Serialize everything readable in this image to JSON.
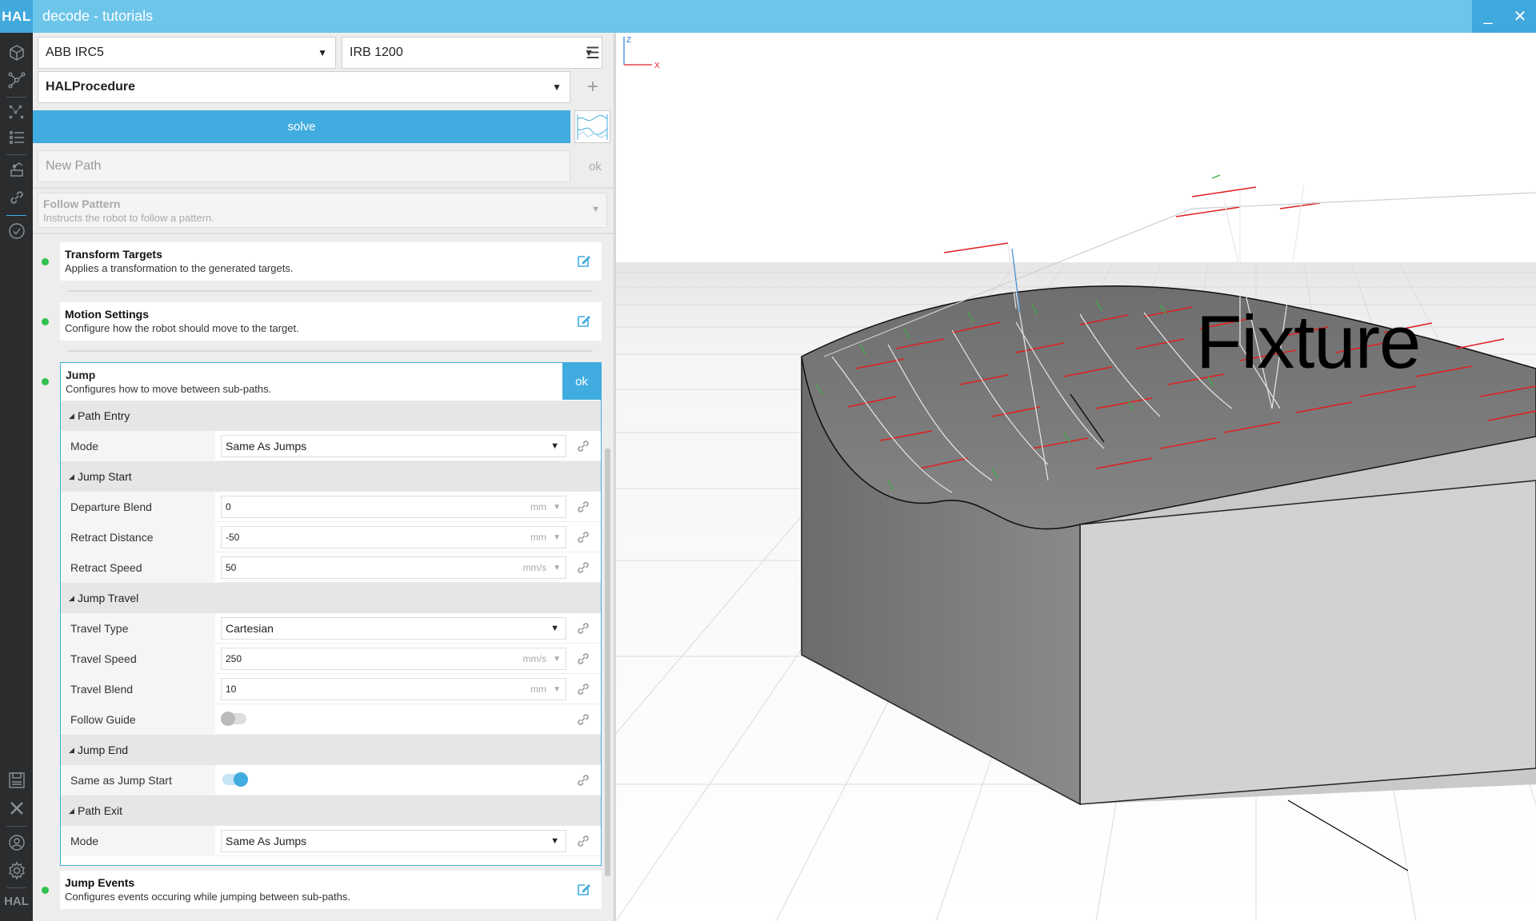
{
  "titlebar": {
    "logo": "HAL",
    "title": "decode - tutorials",
    "minimize": "_",
    "close": "✕"
  },
  "rail": {
    "brand": "HAL",
    "icons": [
      "cube-icon",
      "network-icon",
      "scatter-icon",
      "list-icon",
      "robot-icon",
      "link-icon",
      "check-icon",
      "save-icon",
      "close-icon",
      "user-icon",
      "gear-icon"
    ]
  },
  "panel": {
    "controller": "ABB IRC5",
    "robot": "IRB 1200",
    "procedure": "HALProcedure",
    "solve_label": "solve",
    "new_path_placeholder": "New Path",
    "new_path_ok": "ok",
    "pattern": {
      "title": "Follow Pattern",
      "desc": "Instructs the robot to follow a pattern."
    },
    "steps": [
      {
        "title": "Transform Targets",
        "desc": "Applies a transformation to the generated targets."
      },
      {
        "title": "Motion Settings",
        "desc": "Configure how the robot should move to the target."
      }
    ],
    "jump": {
      "title": "Jump",
      "desc": "Configures how to move between sub-paths.",
      "ok": "ok",
      "sections": {
        "path_entry": "Path Entry",
        "jump_start": "Jump Start",
        "jump_travel": "Jump Travel",
        "jump_end": "Jump End",
        "path_exit": "Path Exit"
      },
      "fields": {
        "entry_mode": {
          "label": "Mode",
          "value": "Same As Jumps"
        },
        "departure_blend": {
          "label": "Departure Blend",
          "value": "0",
          "unit": "mm"
        },
        "retract_distance": {
          "label": "Retract Distance",
          "value": "-50",
          "unit": "mm"
        },
        "retract_speed": {
          "label": "Retract Speed",
          "value": "50",
          "unit": "mm/s"
        },
        "travel_type": {
          "label": "Travel Type",
          "value": "Cartesian"
        },
        "travel_speed": {
          "label": "Travel Speed",
          "value": "250",
          "unit": "mm/s"
        },
        "travel_blend": {
          "label": "Travel Blend",
          "value": "10",
          "unit": "mm"
        },
        "follow_guide": {
          "label": "Follow Guide",
          "on": false
        },
        "same_as_jump_start": {
          "label": "Same as Jump Start",
          "on": true
        },
        "exit_mode": {
          "label": "Mode",
          "value": "Same As Jumps"
        }
      }
    },
    "jump_events": {
      "title": "Jump Events",
      "desc": "Configures events occuring while jumping between sub-paths."
    }
  },
  "viewport": {
    "label": "Fixture",
    "axis_z": "Z",
    "axis_x": "X"
  },
  "colors": {
    "accent": "#41ace0",
    "titlebar": "#6dc5ea",
    "status_ok": "#2ec14f",
    "rail": "#2a2c2e"
  }
}
